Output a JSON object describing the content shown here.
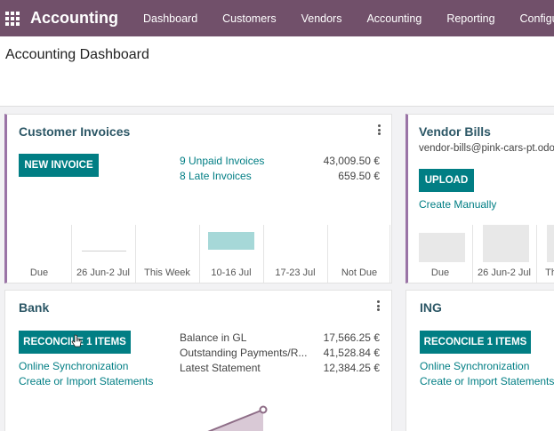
{
  "topbar": {
    "app_name": "Accounting",
    "menu": [
      "Dashboard",
      "Customers",
      "Vendors",
      "Accounting",
      "Reporting",
      "Configuration"
    ]
  },
  "page": {
    "title": "Accounting Dashboard"
  },
  "customer_invoices": {
    "title": "Customer Invoices",
    "button": "NEW INVOICE",
    "stats": [
      {
        "label": "9 Unpaid Invoices",
        "value": "43,009.50 €"
      },
      {
        "label": "8 Late Invoices",
        "value": "659.50 €"
      }
    ],
    "chart_labels": [
      "Due",
      "26 Jun-2 Jul",
      "This Week",
      "10-16 Jul",
      "17-23 Jul",
      "Not Due"
    ]
  },
  "vendor_bills": {
    "title": "Vendor Bills",
    "email": "vendor-bills@pink-cars-pt.odoo.com",
    "button": "UPLOAD",
    "link": "Create Manually",
    "chart_labels": [
      "Due",
      "26 Jun-2 Jul",
      "This Week"
    ]
  },
  "bank": {
    "title": "Bank",
    "button": "RECONCILE 1 ITEMS",
    "links": [
      "Online Synchronization",
      "Create or Import Statements"
    ],
    "stats": [
      {
        "label": "Balance in GL",
        "value": "17,566.25 €"
      },
      {
        "label": "Outstanding Payments/R...",
        "value": "41,528.84 €"
      },
      {
        "label": "Latest Statement",
        "value": "12,384.25 €"
      }
    ]
  },
  "ing": {
    "title": "ING",
    "button": "RECONCILE 1 ITEMS",
    "links": [
      "Online Synchronization",
      "Create or Import Statements"
    ]
  },
  "colors": {
    "topbar": "#71506a",
    "primary": "#017e84",
    "accent_border": "#9a74a6",
    "future_bar": "#a6d8d8",
    "sample_bar": "#e8e8e8"
  }
}
